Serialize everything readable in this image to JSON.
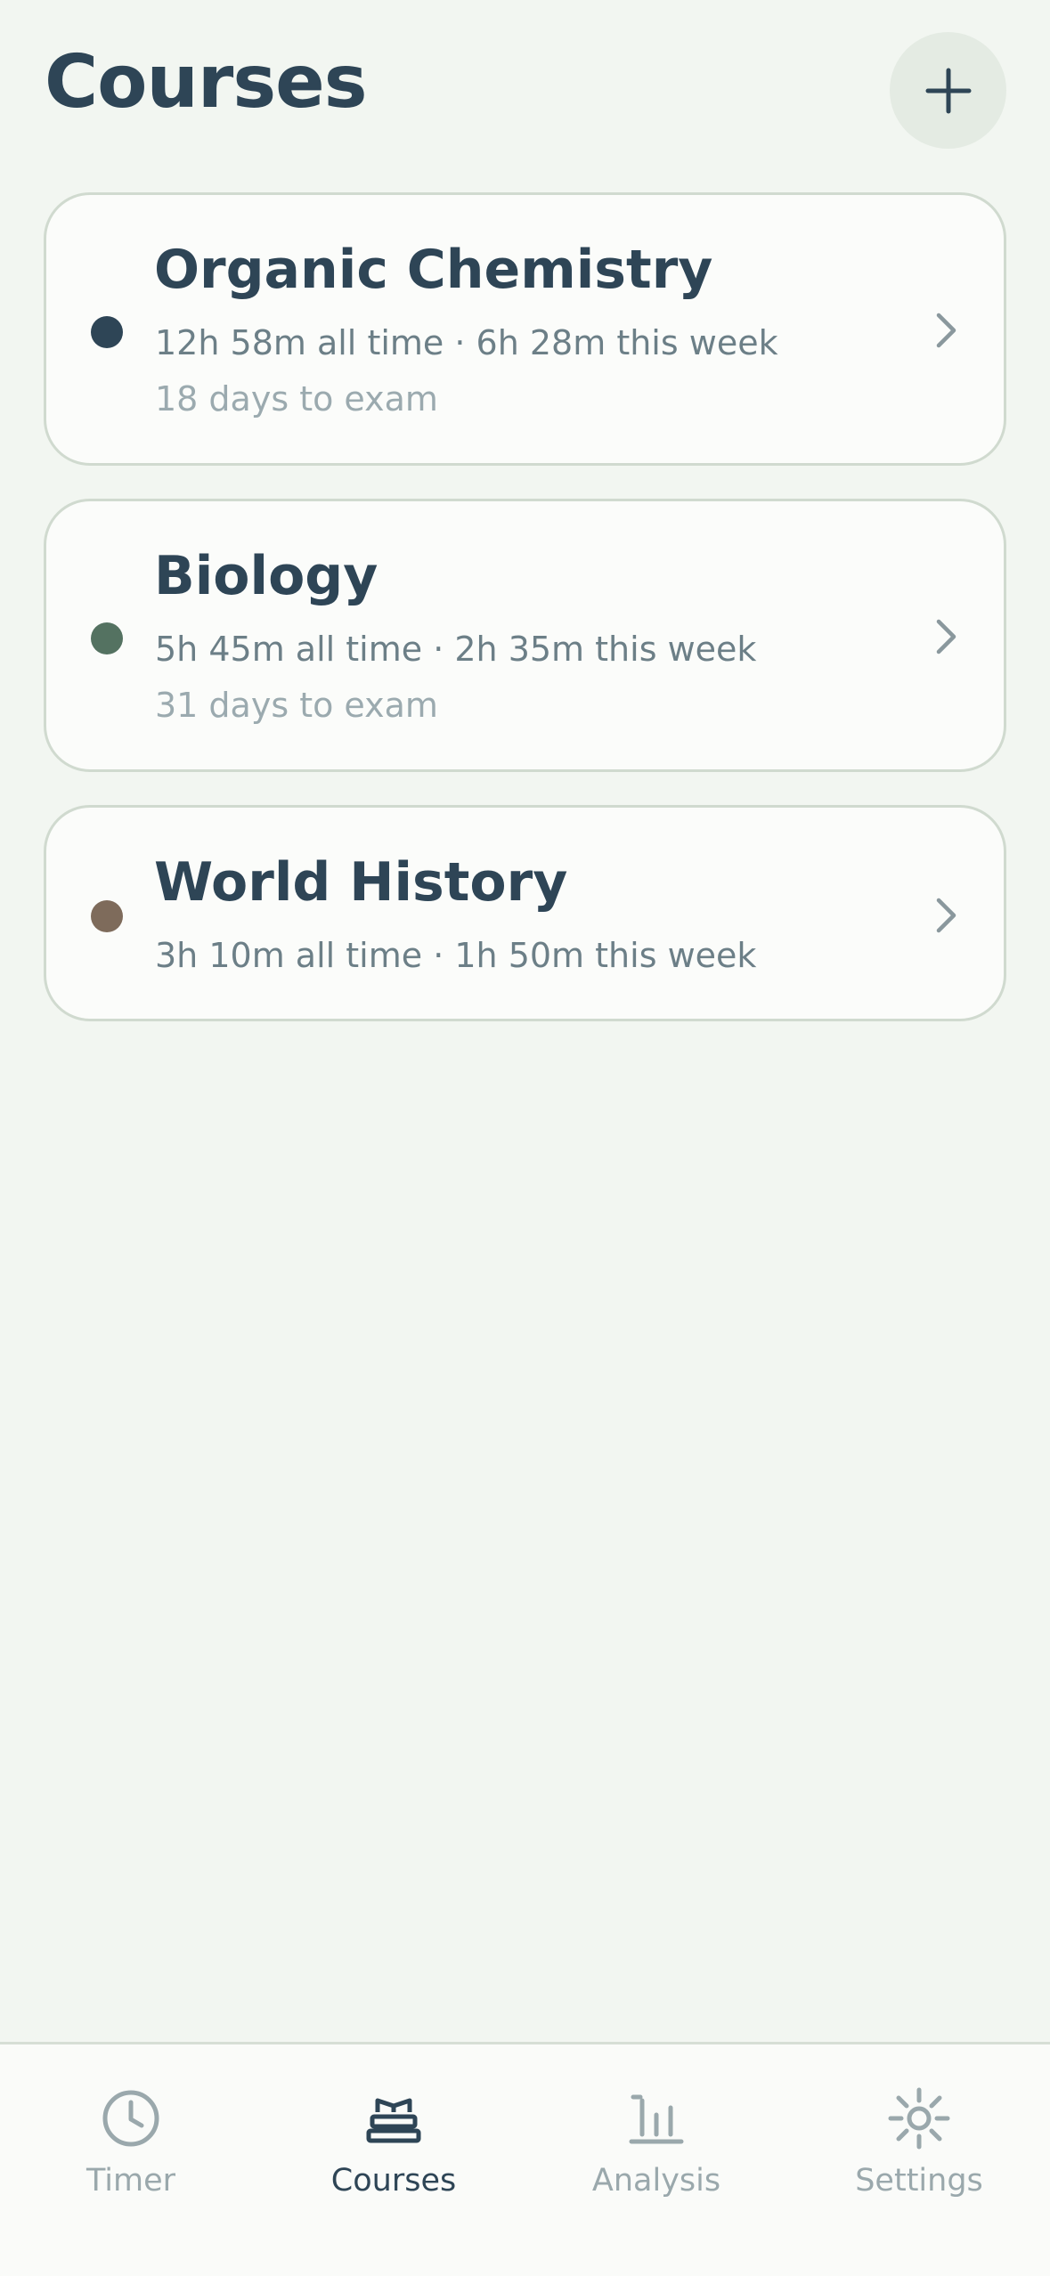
{
  "header": {
    "title": "Courses",
    "add_icon": "plus-icon"
  },
  "courses": [
    {
      "name": "Organic Chemistry",
      "stats": "12h 58m all time · 6h 28m this week",
      "exam": "18 days to exam",
      "color": "#2E4556"
    },
    {
      "name": "Biology",
      "stats": "5h 45m all time · 2h 35m this week",
      "exam": "31 days to exam",
      "color": "#547261"
    },
    {
      "name": "World History",
      "stats": "3h 10m all time · 1h 50m this week",
      "exam": "",
      "color": "#7E6B5B"
    }
  ],
  "tabbar": {
    "tabs": [
      {
        "label": "Timer",
        "icon": "clock-icon",
        "active": false
      },
      {
        "label": "Courses",
        "icon": "books-icon",
        "active": true
      },
      {
        "label": "Analysis",
        "icon": "bar-chart-icon",
        "active": false
      },
      {
        "label": "Settings",
        "icon": "sun-gear-icon",
        "active": false
      }
    ]
  },
  "colors": {
    "background": "#F2F6F1",
    "card": "#FBFCFA",
    "primary_text": "#2E4556",
    "secondary_text": "#6C7F87",
    "muted_text": "#9BAAAF",
    "inactive_tab": "#9AA8AC"
  }
}
